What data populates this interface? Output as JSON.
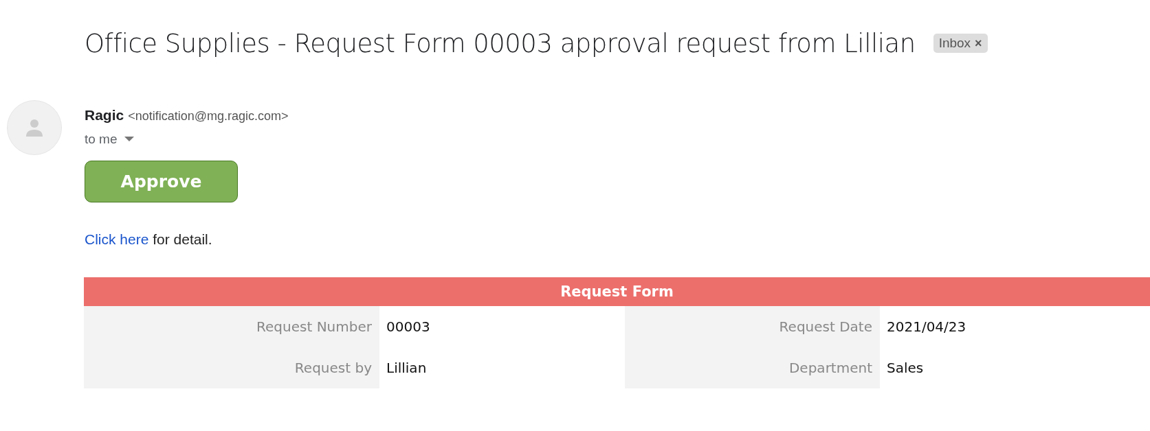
{
  "subject": "Office Supplies - Request Form 00003 approval request from Lillian",
  "label_chip": {
    "label": "Inbox",
    "close": "×"
  },
  "sender": {
    "name": "Ragic",
    "email": "<notification@mg.ragic.com>"
  },
  "recipient": "to me",
  "approve_button": "Approve",
  "detail_line": {
    "link": "Click here",
    "text": " for detail."
  },
  "form": {
    "title": "Request Form",
    "rows": [
      {
        "fields": [
          {
            "label": "Request Number",
            "value": "00003"
          },
          {
            "label": "Request Date",
            "value": "2021/04/23"
          }
        ]
      },
      {
        "fields": [
          {
            "label": "Request by",
            "value": "Lillian"
          },
          {
            "label": "Department",
            "value": "Sales"
          }
        ]
      }
    ]
  }
}
